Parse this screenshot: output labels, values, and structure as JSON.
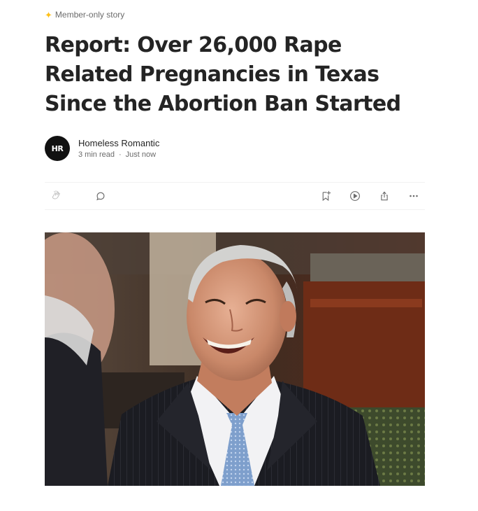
{
  "badge": {
    "icon": "star-icon",
    "label": "Member-only story",
    "accent": "#ffc017"
  },
  "article": {
    "title": "Report: Over 26,000 Rape Related Pregnancies in Texas Since the Abortion Ban Started"
  },
  "author": {
    "avatar_text": "HR",
    "name": "Homeless Romantic",
    "read_time": "3 min read",
    "separator": "·",
    "published": "Just now"
  },
  "actions": {
    "left": [
      "clap-icon",
      "comment-icon"
    ],
    "right": [
      "bookmark-add-icon",
      "listen-icon",
      "share-icon",
      "more-icon"
    ]
  },
  "hero_image": {
    "subject": "photo"
  }
}
